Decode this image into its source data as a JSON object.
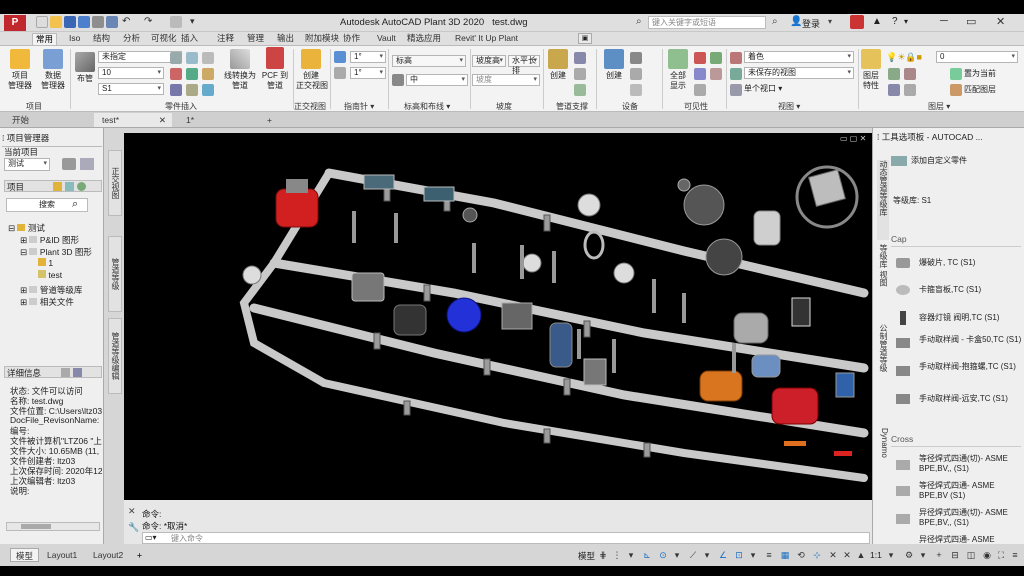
{
  "app": {
    "title": "Autodesk AutoCAD Plant 3D 2020",
    "file": "test.dwg",
    "search_placeholder": "键入关键字或短语",
    "user": "登录",
    "icon_label": "P"
  },
  "ribbon_tabs": [
    "常用",
    "Iso",
    "结构",
    "分析",
    "可视化",
    "插入",
    "注释",
    "管理",
    "输出",
    "附加模块",
    "协作",
    "Vault",
    "精选应用",
    "Revit' It Up Plant"
  ],
  "ribbon": {
    "project_manager": "项目\n管理器",
    "data_manager": "数据\n管理器",
    "pipe": "布管",
    "spec_combo": "未指定",
    "size_combo": "10",
    "line_combo": "S1",
    "convert_line": "线转换为\n管道",
    "pcf": "PCF 到\n管道",
    "create": "创建\n正交视图",
    "angle1": "1°",
    "angle2": "1°",
    "elev": "标高",
    "elev_mid": "中",
    "slope": "坡度高",
    "slope2": "坡度",
    "horizontal": "水平长排",
    "create2": "创建",
    "create3": "创建",
    "all_show": "全部\n显示",
    "color_combo": "着色",
    "view_combo": "未保存的视图",
    "viewport_combo": "单个视口",
    "layer_props": "图层\n特性",
    "layer_value": "0",
    "set_current": "置为当前",
    "match_layer": "匹配图层",
    "panels": {
      "project": "项目",
      "part_insert": "零件插入",
      "ortho": "正交视图",
      "compass": "指南针",
      "elev_route": "标高和布线",
      "slope": "坡度",
      "support": "管道支撑",
      "equipment": "设备",
      "visibility": "可见性",
      "view": "视图",
      "layer": "图层"
    }
  },
  "doc_tabs": [
    "开始",
    "test*",
    "1*"
  ],
  "left_panel": {
    "header": "项目管理器",
    "current_project": "当前项目",
    "project_value": "测试",
    "project_section": "项目",
    "search": "搜索",
    "tree": [
      "测试",
      "P&ID 图形",
      "Plant 3D 图形",
      "1",
      "test",
      "管道等级库",
      "相关文件"
    ],
    "details_header": "详细信息",
    "details": [
      "状态: 文件可以访问",
      "名称: test.dwg",
      "文件位置: C:\\Users\\ltz03",
      "DocFile_RevisonName:",
      "编号:",
      "文件被计算机\"LTZ06 \"上",
      "文件大小: 10.65MB (11,",
      "文件创建者: ltz03",
      "上次保存时间: 2020年12",
      "上次编辑者: ltz03",
      "说明:"
    ],
    "side_tabs": [
      "正交视图",
      "管道等级",
      "管道等级编辑"
    ]
  },
  "command": {
    "line1": "命令:",
    "line2": "命令: *取消*",
    "placeholder": "键入命令"
  },
  "layout_tabs": [
    "模型",
    "Layout1",
    "Layout2"
  ],
  "status": {
    "model": "模型",
    "scale": "1:1"
  },
  "right_panel": {
    "header": "工具选项板 - AUTOCAD ...",
    "add_custom": "添加自定义零件",
    "spec": "等级库: S1",
    "cap": "Cap",
    "cross": "Cross",
    "items": [
      "爆破片, TC (S1)",
      "卡箍盲板,TC (S1)",
      "容器灯镜 阀明,TC (S1)",
      "手动取样阀 - 卡盒50,TC (S1)",
      "手动取样阀-抱箍螺,TC (S1)",
      "手动取样阀-远安,TC (S1)"
    ],
    "cross_items": [
      "等径焊式四通(切)- ASME BPE,BV,, (S1)",
      "等径焊式四通- ASME BPE,BV (S1)",
      "异径焊式四通(切)- ASME BPE,BV,, (S1)",
      "异径焊式四通- ASME"
    ],
    "side_tabs": [
      "动态管道等级库",
      "等级库 视图",
      "公制管道等级",
      "Dynamo"
    ]
  },
  "colors": {
    "title_bg": "#dfdfdf",
    "ribbon_bg": "#f3f3f3",
    "viewport_bg": "#000000",
    "accent": "#c0282d"
  }
}
